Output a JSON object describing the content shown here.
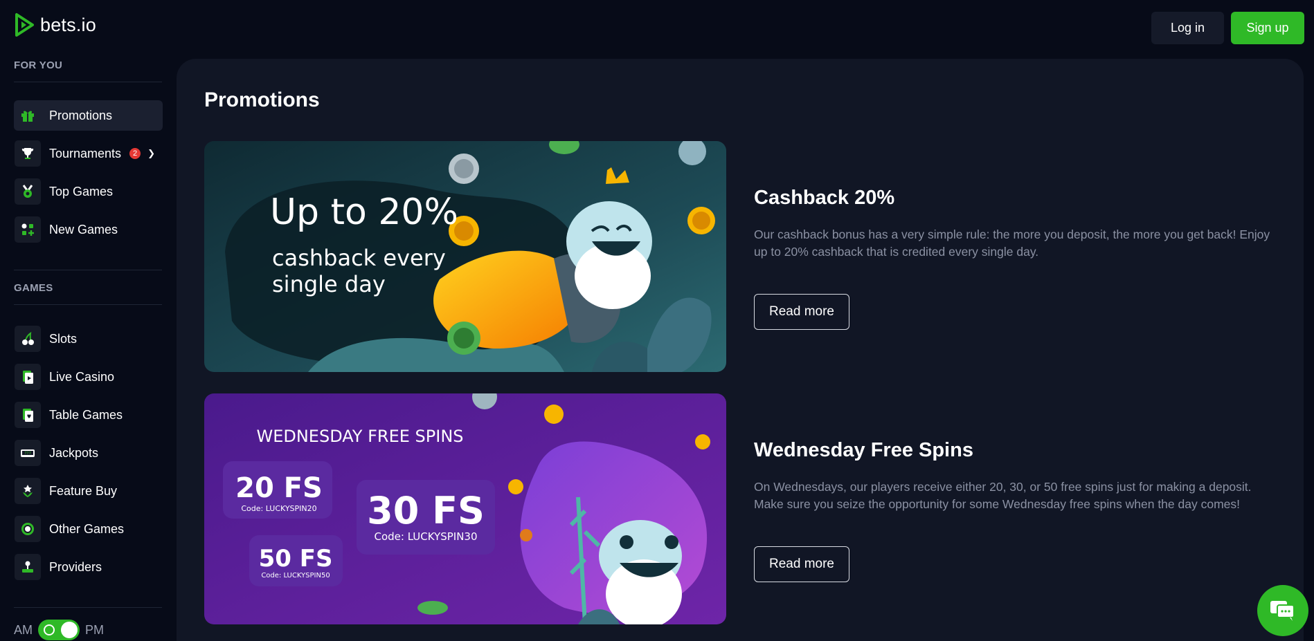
{
  "brand": {
    "name": "bets.io",
    "accent": "#2fb927"
  },
  "header": {
    "login_label": "Log in",
    "signup_label": "Sign up"
  },
  "sidebar": {
    "for_you_label": "FOR YOU",
    "games_label": "GAMES",
    "for_you_items": [
      {
        "label": "Promotions",
        "icon": "gift-icon",
        "active": true
      },
      {
        "label": "Tournaments",
        "icon": "trophy-icon",
        "badge": "2"
      },
      {
        "label": "Top Games",
        "icon": "medal-icon"
      },
      {
        "label": "New Games",
        "icon": "new-games-icon"
      }
    ],
    "game_items": [
      {
        "label": "Slots",
        "icon": "cherry-icon"
      },
      {
        "label": "Live Casino",
        "icon": "live-casino-icon"
      },
      {
        "label": "Table Games",
        "icon": "cards-icon"
      },
      {
        "label": "Jackpots",
        "icon": "jackpot-icon"
      },
      {
        "label": "Feature Buy",
        "icon": "feature-buy-icon"
      },
      {
        "label": "Other Games",
        "icon": "chip-icon"
      },
      {
        "label": "Providers",
        "icon": "joystick-icon"
      }
    ],
    "toggle": {
      "left": "AM",
      "right": "PM"
    }
  },
  "main": {
    "title": "Promotions",
    "promos": [
      {
        "title": "Cashback 20%",
        "description": "Our cashback bonus has a very simple rule: the more you deposit, the more you get back! Enjoy up to 20% cashback that is credited every single day.",
        "button": "Read more",
        "banner": {
          "headline": "Up to 20%",
          "line1": "cashback every",
          "line2": "single day"
        }
      },
      {
        "title": "Wednesday Free Spins",
        "description": "On Wednesdays, our players receive either 20, 30, or 50 free spins just for making a deposit. Make sure you seize the opportunity for some Wednesday free spins when the day comes!",
        "button": "Read more",
        "banner": {
          "heading": "WEDNESDAY FREE SPINS",
          "offers": [
            {
              "fs": "20 FS",
              "code": "Code: LUCKYSPIN20"
            },
            {
              "fs": "30 FS",
              "code": "Code: LUCKYSPIN30"
            },
            {
              "fs": "50 FS",
              "code": "Code: LUCKYSPIN50"
            }
          ]
        }
      }
    ]
  }
}
